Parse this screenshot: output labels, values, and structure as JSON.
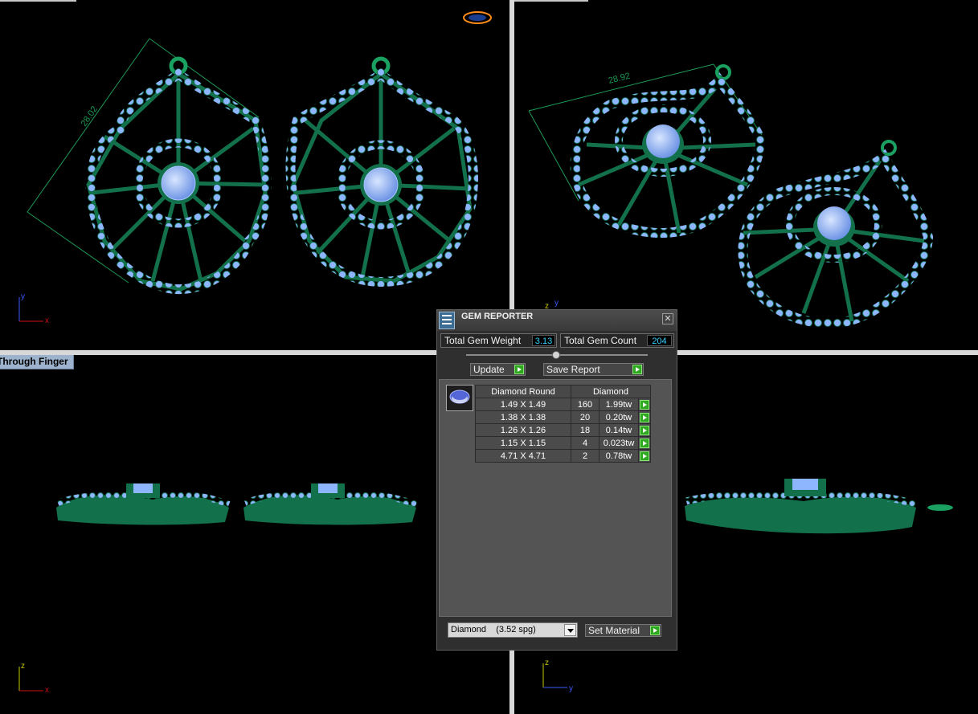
{
  "viewports": {
    "top_left": {
      "dimension_label": "28.02",
      "axes": [
        "y",
        "x"
      ]
    },
    "top_right": {
      "dimension_label": "28.92",
      "axes": [
        "z",
        "y"
      ]
    },
    "bottom_left": {
      "label": "Through Finger",
      "axes": [
        "z",
        "x"
      ]
    },
    "bottom_right": {
      "axes": [
        "z",
        "y"
      ]
    }
  },
  "gem_reporter": {
    "title": "GEM REPORTER",
    "close_label": "✕",
    "total_weight_label": "Total Gem Weight",
    "total_weight_value": "3.13",
    "total_count_label": "Total Gem Count",
    "total_count_value": "204",
    "update_label": "Update",
    "save_report_label": "Save Report",
    "table_headers": [
      "Diamond Round",
      "Diamond"
    ],
    "rows": [
      {
        "size": "1.49 X 1.49",
        "count": "160",
        "weight": "1.99tw"
      },
      {
        "size": "1.38 X 1.38",
        "count": "20",
        "weight": "0.20tw"
      },
      {
        "size": "1.26 X 1.26",
        "count": "18",
        "weight": "0.14tw"
      },
      {
        "size": "1.15 X 1.15",
        "count": "4",
        "weight": "0.023tw"
      },
      {
        "size": "4.71 X 4.71",
        "count": "2",
        "weight": "0.78tw"
      }
    ],
    "material_value": "Diamond    (3.52 spg)",
    "set_material_label": "Set Material"
  },
  "colors": {
    "metal": "#12704a",
    "gem": "#8eb6ff",
    "ui_value": "#34d2ff"
  }
}
